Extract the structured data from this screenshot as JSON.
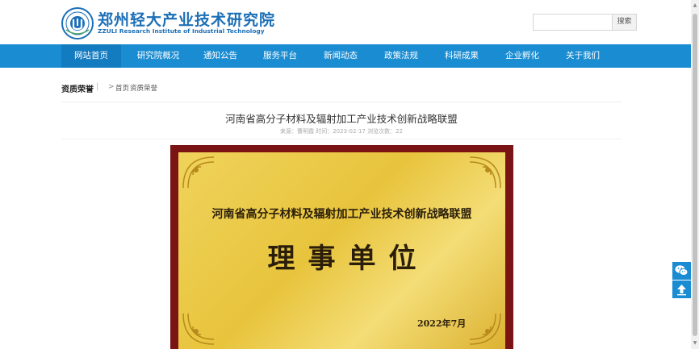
{
  "header": {
    "brand_cn": "郑州轻大产业技术研究院",
    "brand_en": "ZZULI Research Institute of Industrial Technology",
    "search_placeholder": "",
    "search_button": "搜索"
  },
  "nav": {
    "items": [
      {
        "label": "网站首页"
      },
      {
        "label": "研究院概况"
      },
      {
        "label": "通知公告"
      },
      {
        "label": "服务平台"
      },
      {
        "label": "新闻动态"
      },
      {
        "label": "政策法规"
      },
      {
        "label": "科研成果"
      },
      {
        "label": "企业孵化"
      },
      {
        "label": "关于我们"
      }
    ],
    "active_index": 0
  },
  "breadcrumb": {
    "section": "资质荣誉",
    "separator": "|",
    "arrow": ">",
    "home": "首页",
    "current": "资质荣誉"
  },
  "article": {
    "title": "河南省高分子材料及辐射加工产业技术创新战略联盟",
    "meta": "来源：曹明霞  时间：2023-02-17  浏览次数：22"
  },
  "plaque": {
    "line1": "河南省高分子材料及辐射加工产业技术创新战略联盟",
    "line2": "理事单位",
    "date": "2022年7月"
  },
  "floating": {
    "wechat_icon": "wechat-icon",
    "top_icon": "arrow-up-icon"
  },
  "colors": {
    "brand": "#1c6fb6",
    "nav_bg": "#1a8cd2",
    "nav_active": "#137bc0",
    "plaque_frame": "#7b1415",
    "plaque_gold": "#e8c43d"
  }
}
